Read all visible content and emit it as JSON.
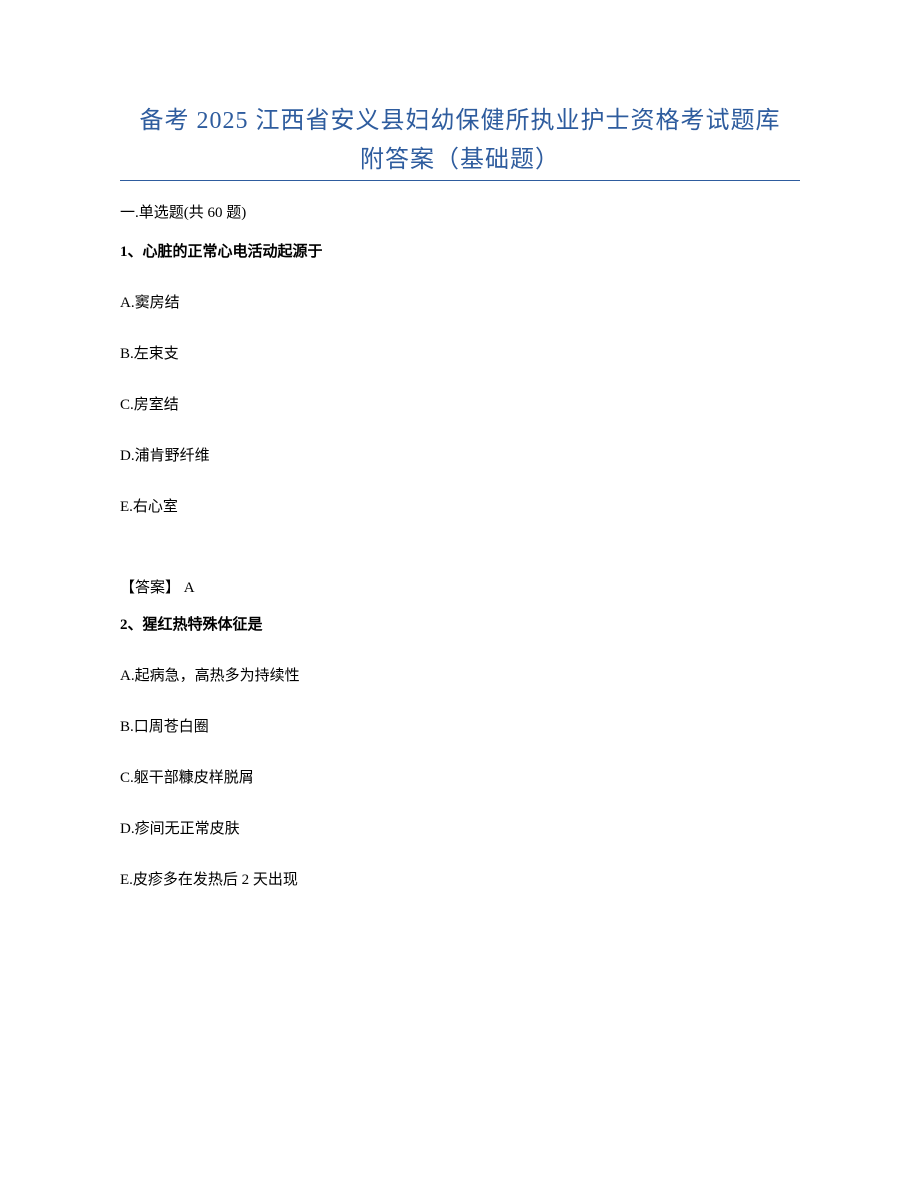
{
  "title": {
    "line1": "备考 2025 江西省安义县妇幼保健所执业护士资格考试题库",
    "line2": "附答案（基础题）"
  },
  "sectionHeader": "一.单选题(共 60 题)",
  "question1": {
    "stem": "1、心脏的正常心电活动起源于",
    "options": {
      "a": "A.窦房结",
      "b": "B.左束支",
      "c": "C.房室结",
      "d": "D.浦肯野纤维",
      "e": "E.右心室"
    },
    "answer": "【答案】 A"
  },
  "question2": {
    "stem": "2、猩红热特殊体征是",
    "options": {
      "a": "A.起病急，高热多为持续性",
      "b": "B.口周苍白圈",
      "c": "C.躯干部糠皮样脱屑",
      "d": "D.疹间无正常皮肤",
      "e": "E.皮疹多在发热后 2 天出现"
    }
  }
}
